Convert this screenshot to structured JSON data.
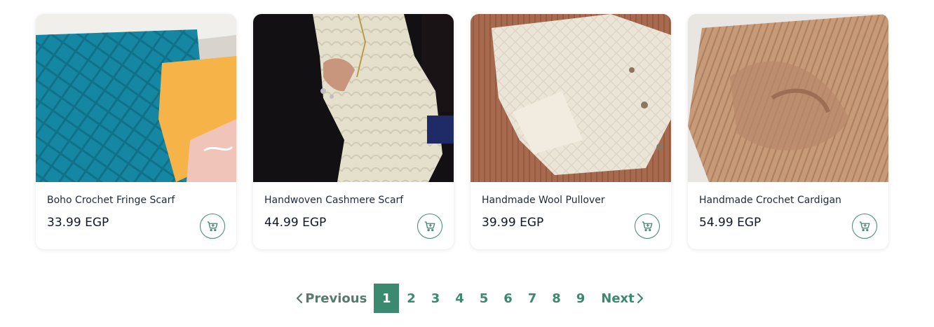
{
  "products": [
    {
      "title": "Boho Crochet Fringe Scarf",
      "price": "33.99 EGP"
    },
    {
      "title": "Handwoven Cashmere Scarf",
      "price": "44.99 EGP"
    },
    {
      "title": "Handmade Wool Pullover",
      "price": "39.99 EGP"
    },
    {
      "title": "Handmade Crochet Cardigan",
      "price": "54.99 EGP"
    }
  ],
  "pagination": {
    "previous_label": "Previous",
    "next_label": "Next",
    "pages": [
      "1",
      "2",
      "3",
      "4",
      "5",
      "6",
      "7",
      "8",
      "9"
    ],
    "current": "1"
  },
  "colors": {
    "accent": "#3b8a6f"
  },
  "icons": {
    "cart": "shopping-cart-plus-icon",
    "prev": "chevron-left-icon",
    "next": "chevron-right-icon"
  }
}
